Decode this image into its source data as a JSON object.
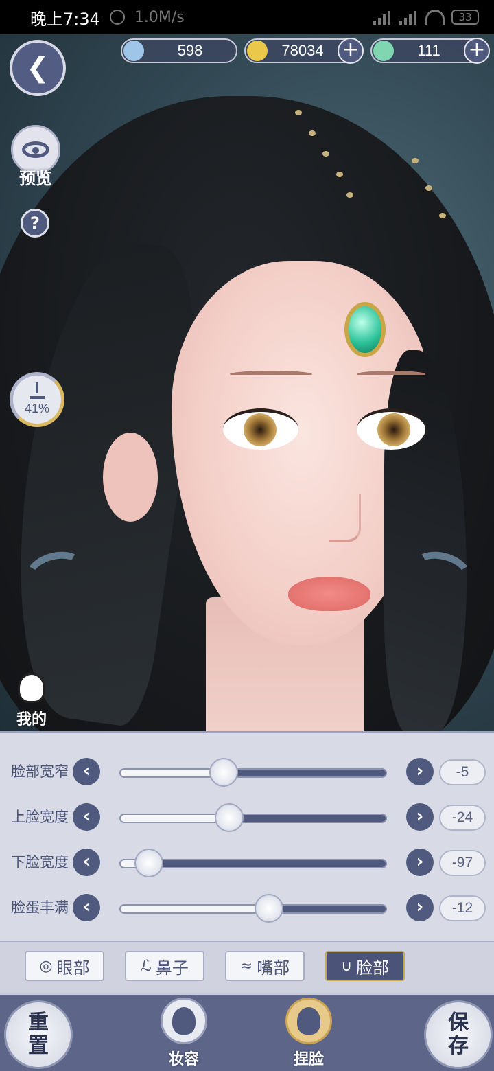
{
  "status_bar": {
    "time": "晚上7:34",
    "speed": "1.0M/s",
    "battery": "33"
  },
  "currencies": [
    {
      "name": "jade",
      "value": "598",
      "icon": "jade-icon",
      "color": "#9fc6e8"
    },
    {
      "name": "coin",
      "value": "78034",
      "icon": "coin-icon",
      "color": "#e9c84a"
    },
    {
      "name": "dragon",
      "value": "111",
      "icon": "dragon-icon",
      "color": "#7fd6b0"
    }
  ],
  "left_buttons": {
    "preview_label": "预览",
    "help_label": "?",
    "download_percent": "41%",
    "mine_label": "我的"
  },
  "sliders": [
    {
      "label": "脸部宽窄",
      "value": "-5",
      "level": 0.39
    },
    {
      "label": "上脸宽度",
      "value": "-24",
      "level": 0.41
    },
    {
      "label": "下脸宽度",
      "value": "-97",
      "level": 0.11
    },
    {
      "label": "脸蛋丰满",
      "value": "-12",
      "level": 0.56
    }
  ],
  "tabs": [
    {
      "label": "眼部",
      "icon": "eye-icon",
      "active": false
    },
    {
      "label": "鼻子",
      "icon": "nose-icon",
      "active": false
    },
    {
      "label": "嘴部",
      "icon": "mouth-icon",
      "active": false
    },
    {
      "label": "脸部",
      "icon": "face-icon",
      "active": true
    }
  ],
  "bottom_nav": {
    "reset_label": "重\n置",
    "makeup_label": "妆容",
    "face_label": "捏脸",
    "save_label": "保\n存"
  },
  "colors": {
    "accent": "#4f5a7e",
    "panel": "#d8dbe6",
    "active_gold": "#c6a95a"
  }
}
